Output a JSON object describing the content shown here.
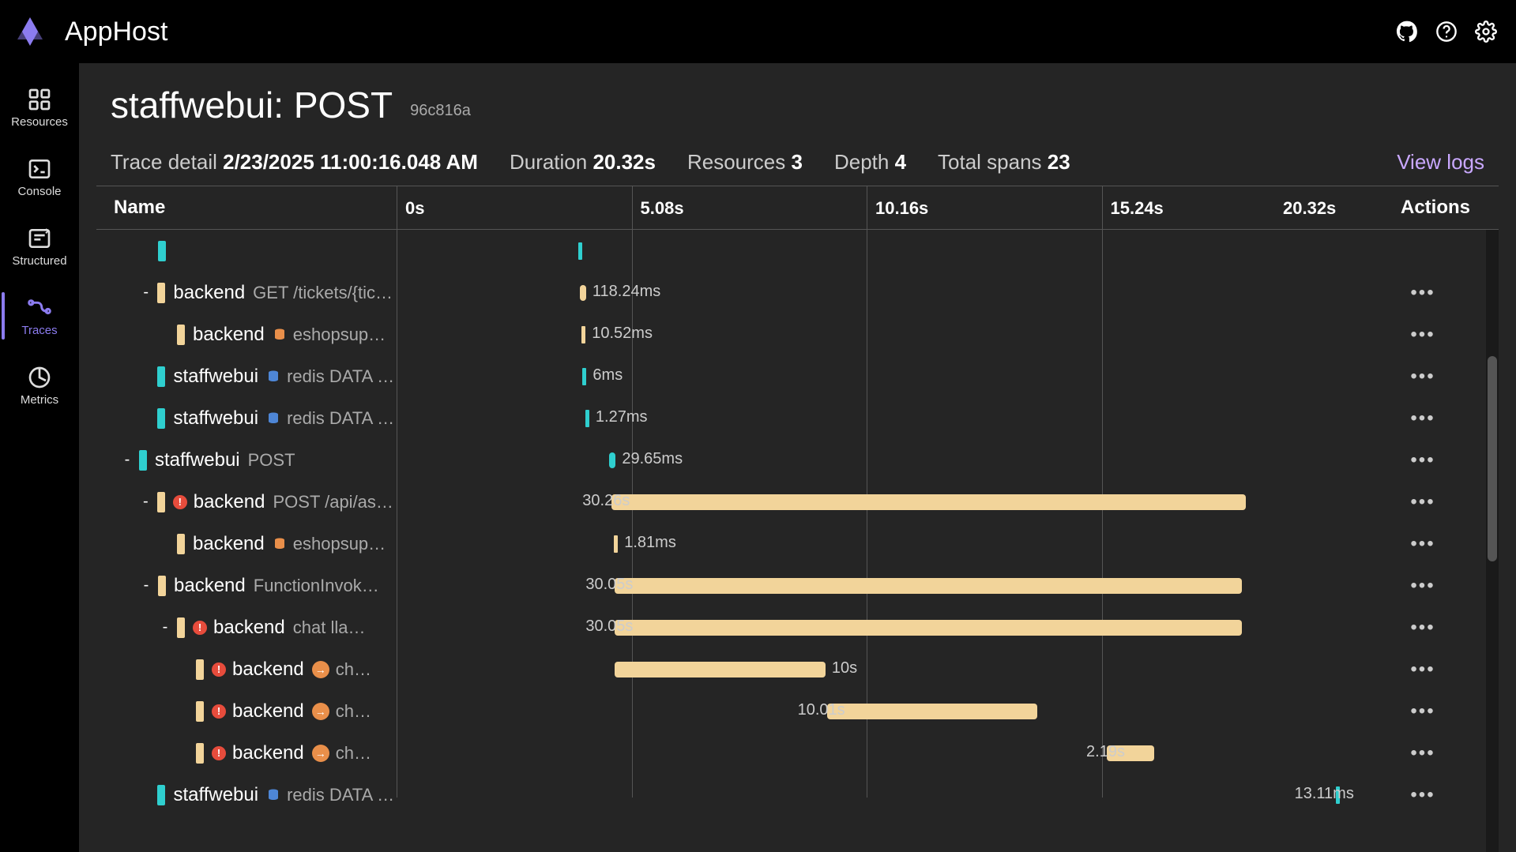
{
  "topbar": {
    "host": "AppHost"
  },
  "nav": {
    "items": [
      {
        "label": "Resources"
      },
      {
        "label": "Console"
      },
      {
        "label": "Structured"
      },
      {
        "label": "Traces"
      },
      {
        "label": "Metrics"
      }
    ],
    "active_index": 3
  },
  "page": {
    "title": "staffwebui: POST",
    "id": "96c816a"
  },
  "stats": {
    "label_detail": "Trace detail ",
    "timestamp": "2/23/2025 11:00:16.048 AM",
    "label_duration": "Duration ",
    "duration": "20.32s",
    "label_resources": "Resources ",
    "resources": "3",
    "label_depth": "Depth ",
    "depth": "4",
    "label_spans": "Total spans ",
    "spans": "23",
    "view_logs": "View logs"
  },
  "columns": {
    "name": "Name",
    "actions": "Actions"
  },
  "ticks": [
    {
      "t": 0.0,
      "label": "0s"
    },
    {
      "t": 5.08,
      "label": "5.08s"
    },
    {
      "t": 10.16,
      "label": "10.16s"
    },
    {
      "t": 15.24,
      "label": "15.24s"
    },
    {
      "t": 20.32,
      "label": "20.32s"
    }
  ],
  "total_s": 20.32,
  "colors": {
    "teal": "#2FCFCF",
    "yellow": "#F2D49A",
    "purple": "#8C7CF0",
    "red": "#E74C3C",
    "orange": "#E98F4A"
  },
  "spans": [
    {
      "indent": 2,
      "expander": "",
      "color": "teal",
      "svc": "",
      "err": false,
      "arrow": false,
      "db": false,
      "db_color": "",
      "desc": "",
      "dur_label": "",
      "bar_color": "teal",
      "start_s": 3.92,
      "len_s": 0.04,
      "tiny": true,
      "label_side": "right",
      "show_actions": false
    },
    {
      "indent": 2,
      "expander": "-",
      "color": "yel",
      "svc": "backend",
      "err": false,
      "arrow": false,
      "db": false,
      "db_color": "",
      "desc": "GET /tickets/{tick…",
      "dur_label": "118.24ms",
      "bar_color": "yel",
      "start_s": 3.96,
      "len_s": 0.118,
      "tiny": false,
      "label_side": "right",
      "show_actions": true
    },
    {
      "indent": 3,
      "expander": "",
      "color": "yel",
      "svc": "backend",
      "err": false,
      "arrow": false,
      "db": true,
      "db_color": "#E98F4A",
      "desc": "eshopsup…",
      "dur_label": "10.52ms",
      "bar_color": "yel",
      "start_s": 4.0,
      "len_s": 0.011,
      "tiny": true,
      "label_side": "right",
      "show_actions": true
    },
    {
      "indent": 2,
      "expander": "",
      "color": "teal",
      "svc": "staffwebui",
      "err": false,
      "arrow": false,
      "db": true,
      "db_color": "#4E86D6",
      "desc": "redis   DATA r…",
      "dur_label": "6ms",
      "bar_color": "teal",
      "start_s": 4.02,
      "len_s": 0.006,
      "tiny": true,
      "label_side": "right",
      "show_actions": true
    },
    {
      "indent": 2,
      "expander": "",
      "color": "teal",
      "svc": "staffwebui",
      "err": false,
      "arrow": false,
      "db": true,
      "db_color": "#4E86D6",
      "desc": "redis   DATA r…",
      "dur_label": "1.27ms",
      "bar_color": "teal",
      "start_s": 4.08,
      "len_s": 0.002,
      "tiny": true,
      "label_side": "right",
      "show_actions": true
    },
    {
      "indent": 1,
      "expander": "-",
      "color": "teal",
      "svc": "staffwebui",
      "err": false,
      "arrow": false,
      "db": false,
      "db_color": "",
      "desc": "POST",
      "dur_label": "29.65ms",
      "bar_color": "teal",
      "start_s": 4.6,
      "len_s": 0.03,
      "tiny": false,
      "label_side": "right",
      "show_actions": true
    },
    {
      "indent": 2,
      "expander": "-",
      "color": "yel",
      "svc": "backend",
      "err": true,
      "arrow": false,
      "db": false,
      "db_color": "",
      "desc": "POST /api/assi…",
      "dur_label": "30.26s",
      "bar_color": "yel",
      "start_s": 4.65,
      "len_s": 13.7,
      "tiny": false,
      "label_side": "left",
      "show_actions": true
    },
    {
      "indent": 3,
      "expander": "",
      "color": "yel",
      "svc": "backend",
      "err": false,
      "arrow": false,
      "db": true,
      "db_color": "#E98F4A",
      "desc": "eshopsup…",
      "dur_label": "1.81ms",
      "bar_color": "yel",
      "start_s": 4.7,
      "len_s": 0.002,
      "tiny": true,
      "label_side": "right",
      "show_actions": true
    },
    {
      "indent": 2,
      "expander": "-",
      "color": "yel",
      "svc": "backend",
      "err": false,
      "arrow": false,
      "db": false,
      "db_color": "",
      "desc": "FunctionInvok…",
      "dur_label": "30.05s",
      "bar_color": "yel",
      "start_s": 4.72,
      "len_s": 13.55,
      "tiny": false,
      "label_side": "left",
      "show_actions": true
    },
    {
      "indent": 3,
      "expander": "-",
      "color": "yel",
      "svc": "backend",
      "err": true,
      "arrow": false,
      "db": false,
      "db_color": "",
      "desc": "chat lla…",
      "dur_label": "30.05s",
      "bar_color": "yel",
      "start_s": 4.72,
      "len_s": 13.55,
      "tiny": false,
      "label_side": "left",
      "show_actions": true
    },
    {
      "indent": 4,
      "expander": "",
      "color": "yel",
      "svc": "backend",
      "err": true,
      "arrow": true,
      "db": false,
      "db_color": "",
      "desc": "ch…",
      "dur_label": "10s",
      "bar_color": "yel",
      "start_s": 4.72,
      "len_s": 4.55,
      "tiny": false,
      "label_side": "right",
      "show_actions": true
    },
    {
      "indent": 4,
      "expander": "",
      "color": "yel",
      "svc": "backend",
      "err": true,
      "arrow": true,
      "db": false,
      "db_color": "",
      "desc": "ch…",
      "dur_label": "10.01s",
      "bar_color": "yel",
      "start_s": 9.3,
      "len_s": 4.55,
      "tiny": false,
      "label_side": "left",
      "show_actions": true
    },
    {
      "indent": 4,
      "expander": "",
      "color": "yel",
      "svc": "backend",
      "err": true,
      "arrow": true,
      "db": false,
      "db_color": "",
      "desc": "ch…",
      "dur_label": "2.19s",
      "bar_color": "yel",
      "start_s": 15.35,
      "len_s": 1.02,
      "tiny": false,
      "label_side": "left",
      "show_actions": true
    },
    {
      "indent": 2,
      "expander": "",
      "color": "teal",
      "svc": "staffwebui",
      "err": false,
      "arrow": false,
      "db": true,
      "db_color": "#4E86D6",
      "desc": "redis   DATA r…",
      "dur_label": "13.11ms",
      "bar_color": "teal",
      "start_s": 20.3,
      "len_s": 0.013,
      "tiny": true,
      "label_side": "left",
      "show_actions": true
    }
  ]
}
